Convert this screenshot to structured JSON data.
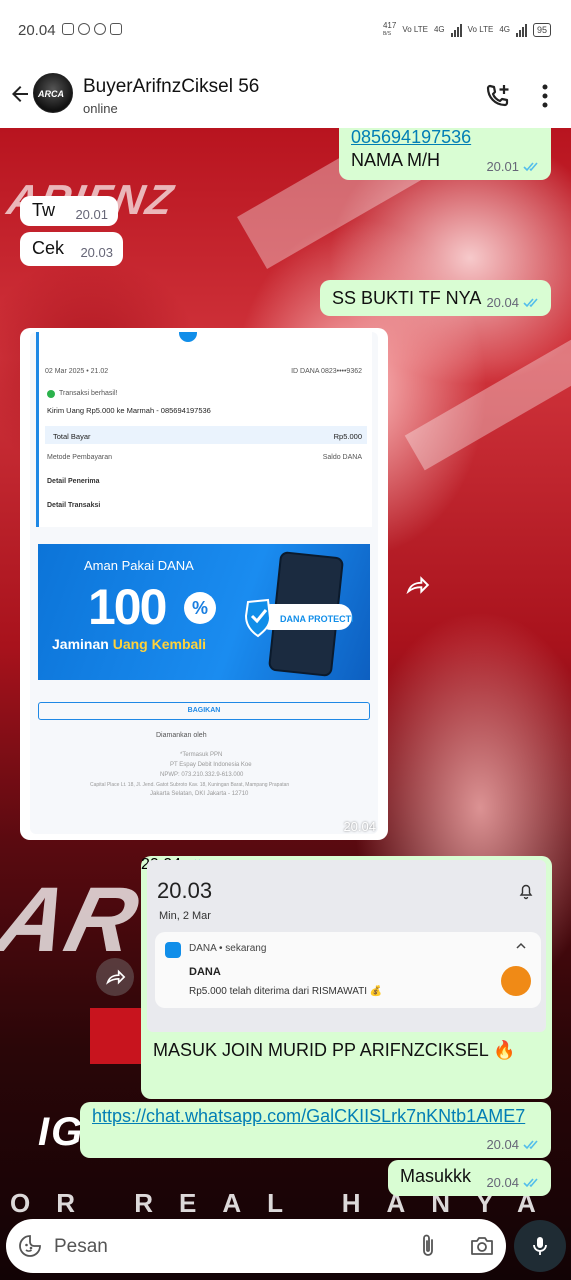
{
  "status_bar": {
    "time": "20.04",
    "net_speed_value": "417",
    "net_speed_unit": "B/S",
    "sim1_label": "Vo LTE",
    "sim1_net": "4G",
    "sim2_label": "Vo LTE",
    "sim2_net": "4G",
    "battery": "95"
  },
  "header": {
    "contact_name": "BuyerArifnzCiksel 56",
    "status": "online",
    "avatar_text": "ARCA"
  },
  "messages": [
    {
      "id": "m1",
      "direction": "out",
      "text_top": "085694197536",
      "text": "NAMA M/H",
      "time": "20.01"
    },
    {
      "id": "m2",
      "direction": "in",
      "text": "Tw",
      "time": "20.01"
    },
    {
      "id": "m3",
      "direction": "in",
      "text": "Cek",
      "time": "20.03"
    },
    {
      "id": "m4",
      "direction": "out",
      "text": "SS BUKTI TF NYA",
      "time": "20.04"
    },
    {
      "id": "m5",
      "direction": "in",
      "type": "image",
      "time": "20.04"
    },
    {
      "id": "m6",
      "direction": "out",
      "type": "image",
      "caption": "MASUK JOIN MURID PP ARIFNZCIKSEL 🔥",
      "time": "20.04"
    },
    {
      "id": "m7",
      "direction": "out",
      "text": "https://chat.whatsapp.com/GalCKIISLrk7nKNtb1AME7",
      "time": "20.04"
    },
    {
      "id": "m8",
      "direction": "out",
      "text": "Masukkk",
      "time": "20.04"
    }
  ],
  "dana_receipt": {
    "date": "02 Mar 2025 • 21.02",
    "id_dana": "ID DANA 0823••••9362",
    "status": "Transaksi berhasil!",
    "description": "Kirim Uang Rp5.000 ke Marmah - 085694197536",
    "total_label": "Total Bayar",
    "total_value": "Rp5.000",
    "method_label": "Metode Pembayaran",
    "method_value": "Saldo DANA",
    "recipient_label": "Detail Penerima",
    "transaction_label": "Detail Transaksi",
    "banner_title": "Aman Pakai DANA",
    "banner_100": "100",
    "banner_pct": "%",
    "banner_sub_1": "Jaminan",
    "banner_sub_2": "Uang Kembali",
    "badge": "DANA PROTECTION",
    "share_button": "BAGIKAN",
    "secured_by": "Diamankan oleh",
    "footer_1": "*Termasuk PPN",
    "footer_2": "PT Espay Debit Indonesia Koe",
    "footer_3": "NPWP: 073.210.332.9-613.000",
    "footer_4": "Capital Place Lt. 18, Jl. Jend. Gatot Subroto Kav. 18, Kuningan Barat, Mampang Prapatan",
    "footer_5": "Jakarta Selatan, DKI Jakarta - 12710"
  },
  "notification": {
    "time_big": "20.03",
    "date": "Min, 2 Mar",
    "app": "DANA • sekarang",
    "title": "DANA",
    "body": "Rp5.000 telah diterima dari RISMAWATI 💰"
  },
  "background_text": {
    "top_left": "ARIFNZ",
    "mid_left": "AR",
    "ig": "IG",
    "bottom": "OR REAL HANYA DI I"
  },
  "input": {
    "placeholder": "Pesan"
  },
  "colors": {
    "outgoing_bubble": "#d9fdd3",
    "incoming_bubble": "#ffffff",
    "link": "#027eb5",
    "read_ticks": "#53bdeb",
    "dana_blue": "#118ee9"
  }
}
